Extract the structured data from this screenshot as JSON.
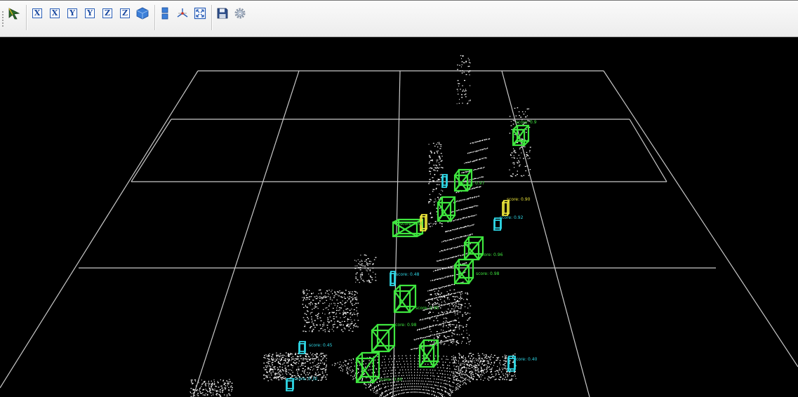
{
  "toolbar": {
    "buttons": [
      {
        "name": "select-tool",
        "icon": "pointer-arrow-icon"
      },
      {
        "name": "view-x-positive",
        "icon": "axis-x-icon",
        "glyph": "X"
      },
      {
        "name": "view-x-negative",
        "icon": "axis-x-icon",
        "glyph": "X"
      },
      {
        "name": "view-y-positive",
        "icon": "axis-y-icon",
        "glyph": "Y"
      },
      {
        "name": "view-y-negative",
        "icon": "axis-y-icon",
        "glyph": "Y"
      },
      {
        "name": "view-z-positive",
        "icon": "axis-z-icon",
        "glyph": "Z"
      },
      {
        "name": "view-z-negative",
        "icon": "axis-z-icon",
        "glyph": "Z"
      },
      {
        "name": "view-iso",
        "icon": "cube-icon"
      },
      {
        "name": "projection-toggle",
        "icon": "layers-icon"
      },
      {
        "name": "center-rotation",
        "icon": "axes-tripod-icon"
      },
      {
        "name": "fit-view",
        "icon": "fullscreen-icon"
      },
      {
        "name": "save-view",
        "icon": "floppy-disk-icon"
      },
      {
        "name": "settings",
        "icon": "gear-icon"
      }
    ]
  },
  "colors": {
    "grid": "#c8c8c8",
    "points": "#ffffff",
    "car_box": "#3fe63f",
    "pedestrian_box": "#2fd8e6",
    "cyclist_box": "#e8e23a",
    "toolbar_icon": "#2b5fb8"
  },
  "detections": {
    "score_labels": [
      {
        "class": "car",
        "text": "score: 0.9"
      },
      {
        "class": "car",
        "text": "score: 0.97"
      },
      {
        "class": "cyclist",
        "text": "score: 0.90"
      },
      {
        "class": "pedestrian",
        "text": "score: 0.92"
      },
      {
        "class": "car",
        "text": "score: 0.95"
      },
      {
        "class": "car",
        "text": "score: 0.96"
      },
      {
        "class": "car",
        "text": "score: 0.98"
      },
      {
        "class": "pedestrian",
        "text": "score: 0.48"
      },
      {
        "class": "car",
        "text": "score: 0.95"
      },
      {
        "class": "car",
        "text": "score: 0.98"
      },
      {
        "class": "pedestrian",
        "text": "score: 0.40"
      },
      {
        "class": "pedestrian",
        "text": "score: 0.45"
      },
      {
        "class": "pedestrian",
        "text": "score: 0.32"
      },
      {
        "class": "car",
        "text": "score: 1.00"
      }
    ]
  }
}
